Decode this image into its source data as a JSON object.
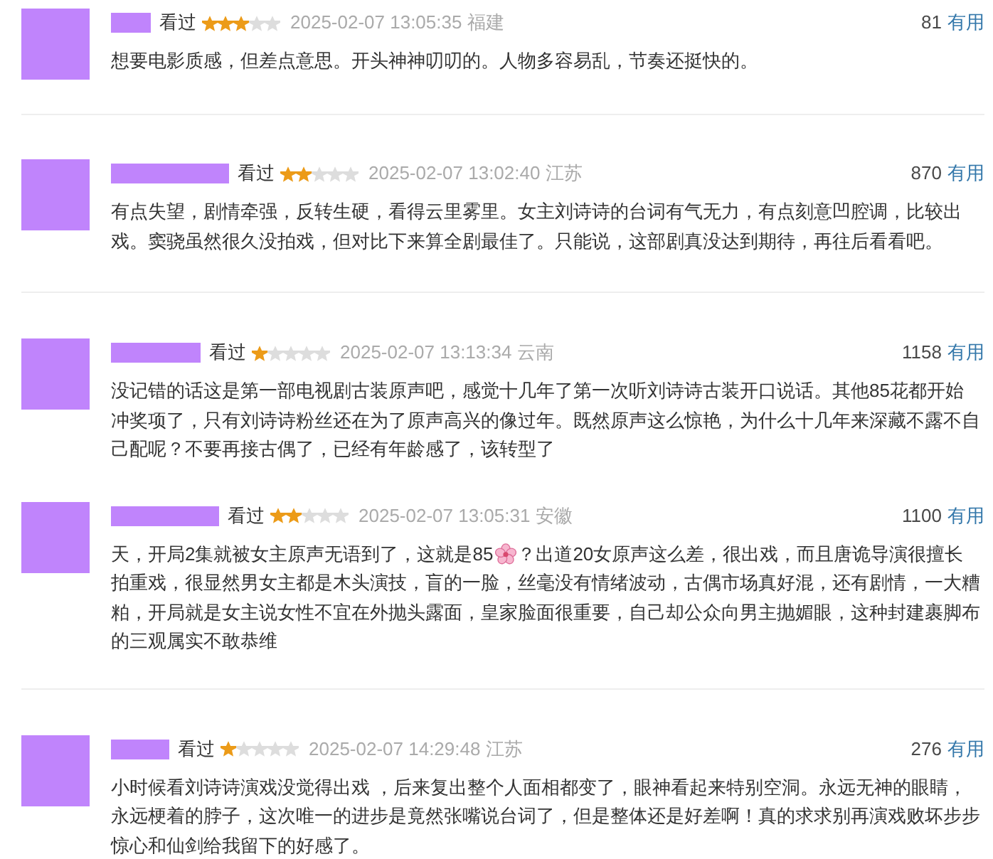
{
  "reviews": [
    {
      "status": "看过",
      "stars": 3,
      "date": "2025-02-07 13:05:35",
      "location": "福建",
      "useful_count": "81",
      "useful_label": "有用",
      "body": [
        {
          "kind": "text",
          "text": "想要电影质感，但差点意思。开头神神叨叨的。人物多容易乱，节奏还挺快的。"
        }
      ]
    },
    {
      "status": "看过",
      "stars": 2,
      "date": "2025-02-07 13:02:40",
      "location": "江苏",
      "useful_count": "870",
      "useful_label": "有用",
      "body": [
        {
          "kind": "text",
          "text": "有点失望，剧情牵强，反转生硬，看得云里雾里。女主刘诗诗的台词有气无力，有点刻意凹腔调，比较出戏。窦骁虽然很久没拍戏，但对比下来算全剧最佳了。只能说，这部剧真没达到期待，再往后看看吧。"
        }
      ]
    },
    {
      "status": "看过",
      "stars": 1,
      "date": "2025-02-07 13:13:34",
      "location": "云南",
      "useful_count": "1158",
      "useful_label": "有用",
      "body": [
        {
          "kind": "text",
          "text": "没记错的话这是第一部电视剧古装原声吧，感觉十几年了第一次听刘诗诗古装开口说话。其他85花都开始冲奖项了，只有刘诗诗粉丝还在为了原声高兴的像过年。既然原声这么惊艳，为什么十几年来深藏不露不自己配呢？不要再接古偶了，已经有年龄感了，该转型了"
        }
      ]
    },
    {
      "status": "看过",
      "stars": 2,
      "date": "2025-02-07 13:05:31",
      "location": "安徽",
      "useful_count": "1100",
      "useful_label": "有用",
      "body": [
        {
          "kind": "text",
          "text": "天，开局2集就被女主原声无语到了，这就是85"
        },
        {
          "kind": "emoji"
        },
        {
          "kind": "text",
          "text": "？出道20女原声这么差，很出戏，而且唐诡导演很擅长拍重戏，很显然男女主都是木头演技，盲的一脸，丝毫没有情绪波动，古偶市场真好混，还有剧情，一大糟粕，开局就是女主说女性不宜在外抛头露面，皇家脸面很重要，自己却公众向男主抛媚眼，这种封建裹脚布的三观属实不敢恭维"
        }
      ]
    },
    {
      "status": "看过",
      "stars": 1,
      "date": "2025-02-07 14:29:48",
      "location": "江苏",
      "useful_count": "276",
      "useful_label": "有用",
      "body": [
        {
          "kind": "text",
          "text": "小时候看刘诗诗演戏没觉得出戏 ，后来复出整个人面相都变了，眼神看起来特别空洞。永远无神的眼睛，永远梗着的脖子，这次唯一的进步是竟然张嘴说台词了，但是整体还是好差啊！真的求求别再演戏败坏步步惊心和仙剑给我留下的好感了。"
        }
      ]
    }
  ]
}
